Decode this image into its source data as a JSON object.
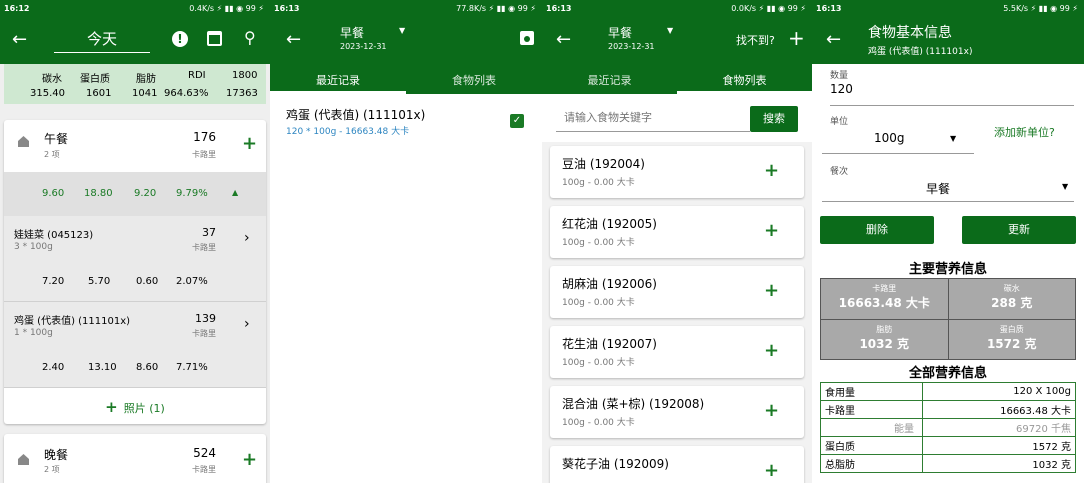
{
  "p1": {
    "status": {
      "time": "16:12",
      "right": "0.4K/s ⚡ ▮▮ ◉ 99 ⚡"
    },
    "title": "今天",
    "summary": {
      "headers": [
        "碳水",
        "蛋白质",
        "脂肪",
        "RDI",
        "1800"
      ],
      "values": [
        "315.40",
        "1601",
        "1041",
        "964.63%",
        "17363"
      ]
    },
    "lunch": {
      "name": "午餐",
      "count": "2 项",
      "cal": "176",
      "unit": "卡路里",
      "totals": [
        "9.60",
        "18.80",
        "9.20",
        "9.79%"
      ]
    },
    "items": [
      {
        "name": "娃娃菜 (045123)",
        "qty": "3 * 100g",
        "cal": "37",
        "unit": "卡路里",
        "vals": [
          "7.20",
          "5.70",
          "0.60",
          "2.07%"
        ]
      },
      {
        "name": "鸡蛋 (代表值) (111101x)",
        "qty": "1 * 100g",
        "cal": "139",
        "unit": "卡路里",
        "vals": [
          "2.40",
          "13.10",
          "8.60",
          "7.71%"
        ]
      }
    ],
    "photo": "照片 (1)",
    "dinner": {
      "name": "晚餐",
      "count": "2 项",
      "cal": "524",
      "unit": "卡路里"
    }
  },
  "p2": {
    "status": {
      "time": "16:13",
      "right": "77.8K/s ⚡ ▮▮ ◉ 99 ⚡"
    },
    "meal": "早餐",
    "date": "2023-12-31",
    "tabs": [
      "最近记录",
      "食物列表"
    ],
    "item": {
      "name": "鸡蛋 (代表值) (111101x)",
      "sub": "120 * 100g - 16663.48 大卡"
    }
  },
  "p3": {
    "status": {
      "time": "16:13",
      "right": "0.0K/s ⚡ ▮▮ ◉ 99 ⚡"
    },
    "meal": "早餐",
    "date": "2023-12-31",
    "notfound": "找不到?",
    "tabs": [
      "最近记录",
      "食物列表"
    ],
    "search": {
      "placeholder": "请输入食物关键字",
      "button": "搜索"
    },
    "foods": [
      {
        "name": "豆油 (192004)",
        "sub": "100g - 0.00 大卡"
      },
      {
        "name": "红花油 (192005)",
        "sub": "100g - 0.00 大卡"
      },
      {
        "name": "胡麻油 (192006)",
        "sub": "100g - 0.00 大卡"
      },
      {
        "name": "花生油 (192007)",
        "sub": "100g - 0.00 大卡"
      },
      {
        "name": "混合油 (菜+棕) (192008)",
        "sub": "100g - 0.00 大卡"
      },
      {
        "name": "葵花子油 (192009)",
        "sub": ""
      }
    ]
  },
  "p4": {
    "status": {
      "time": "16:13",
      "right": "5.5K/s ⚡ ▮▮ ◉ 99 ⚡"
    },
    "title": "食物基本信息",
    "subtitle": "鸡蛋 (代表值) (111101x)",
    "qty_label": "数量",
    "qty": "120",
    "unit_label": "单位",
    "unit": "100g",
    "add_unit": "添加新单位?",
    "meal_label": "餐次",
    "meal": "早餐",
    "delete": "删除",
    "update": "更新",
    "main_title": "主要营养信息",
    "main": [
      {
        "label": "卡路里",
        "value": "16663.48 大卡"
      },
      {
        "label": "碳水",
        "value": "288 克"
      },
      {
        "label": "脂肪",
        "value": "1032 克"
      },
      {
        "label": "蛋白质",
        "value": "1572 克"
      }
    ],
    "all_title": "全部营养信息",
    "rows": [
      {
        "k": "食用量",
        "v": "120 X 100g",
        "sub": false
      },
      {
        "k": "卡路里",
        "v": "16663.48 大卡",
        "sub": false
      },
      {
        "k": "能量",
        "v": "69720 千焦",
        "sub": true
      },
      {
        "k": "蛋白质",
        "v": "1572 克",
        "sub": false
      },
      {
        "k": "总脂肪",
        "v": "1032 克",
        "sub": false
      }
    ]
  }
}
